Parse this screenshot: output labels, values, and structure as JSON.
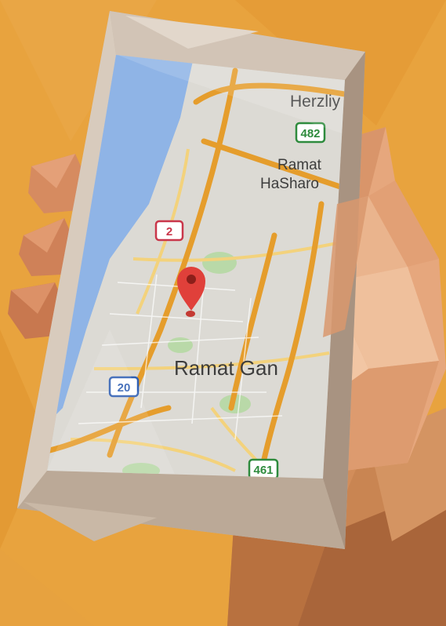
{
  "colors": {
    "background": "#e8a33e",
    "sea": "#8fb4e6",
    "land": "#dcdad4",
    "major_road": "#e59d2c",
    "minor_road": "#f3d27c",
    "park": "#b9d9a8",
    "pin": "#e0403a",
    "phone_frame": "#c7b7a6",
    "skin": "#d89066"
  },
  "map": {
    "places": {
      "herzliya": "Herzliy",
      "ramat_line1": "Ramat",
      "ramat_line2": "HaSharo",
      "ramat_gan": "Ramat Gan"
    },
    "shields": [
      {
        "id": "route-482",
        "label": "482",
        "style": "green"
      },
      {
        "id": "route-2",
        "label": "2",
        "style": "red"
      },
      {
        "id": "route-20",
        "label": "20",
        "style": "blue"
      },
      {
        "id": "route-461",
        "label": "461",
        "style": "green"
      }
    ],
    "pin_icon": "map-pin-icon"
  }
}
